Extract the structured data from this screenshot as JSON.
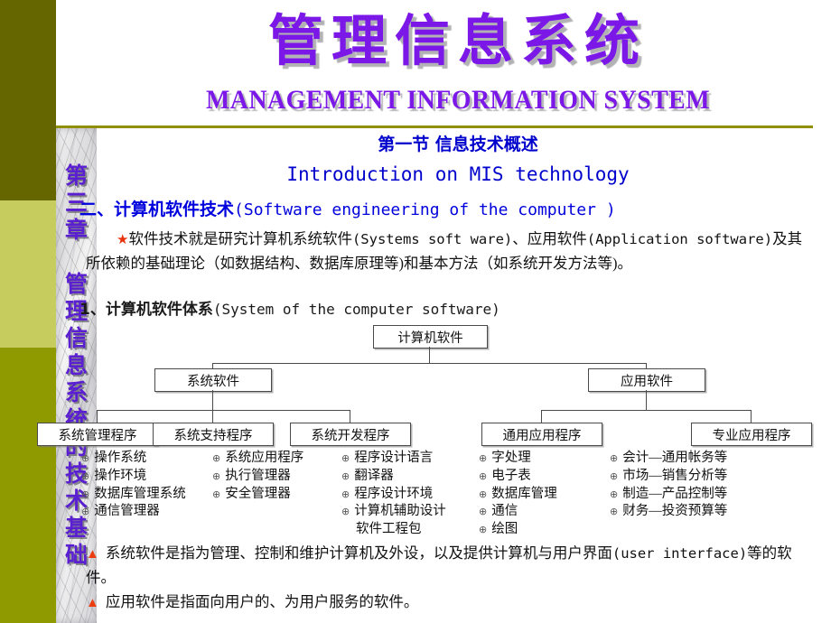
{
  "theme": {
    "band_dark": "#666600",
    "band_light": "#c6cc5e",
    "band_mid": "#8f9900",
    "title_purple": "#7b18e8",
    "heading_blue": "#0000cc",
    "accent_red": "#e8300a",
    "rule_olive": "#8f8f00"
  },
  "sidebar": {
    "vertical_title": "第三章 管理信息系统的技术基础"
  },
  "header": {
    "title_cn": "管理信息系统",
    "title_en": "MANAGEMENT INFORMATION SYSTEM"
  },
  "section": {
    "heading_cn": "第一节 信息技术概述",
    "heading_en": "Introduction on MIS technology",
    "h2_cn": "二、计算机软件技术",
    "h2_en": "(Software engineering of the computer )",
    "h3_cn": "1、计算机软件体系",
    "h3_en": "(System of the computer software)"
  },
  "paragraph": {
    "bullet": "★",
    "text": "软件技术就是研究计算机系统软件(Systems soft ware)、应用软件(Application software)及其所依赖的基础理论（如数据结构、数据库原理等)和基本方法（如系统开发方法等)。",
    "line1_pre": "软件技术就是研究计算机系统软件",
    "line1_mono": "(Systems soft ware)",
    "line1_post": "、应用软件",
    "line2_mono": "(Application software)",
    "line2_post": "及其所依赖的基础理论（如数据结构、数据库原理等)和基本方法（如系统开发方法等)。"
  },
  "tree": {
    "root": "计算机软件",
    "branches": [
      {
        "label": "系统软件",
        "children": [
          "系统管理程序",
          "系统支持程序",
          "系统开发程序"
        ]
      },
      {
        "label": "应用软件",
        "children": [
          "通用应用程序",
          "专业应用程序"
        ]
      }
    ]
  },
  "lists": [
    {
      "parent": "系统管理程序",
      "items": [
        "操作系统",
        "操作环境",
        "数据库管理系统",
        "通信管理器"
      ]
    },
    {
      "parent": "系统支持程序",
      "items": [
        "系统应用程序",
        "执行管理器",
        "安全管理器"
      ]
    },
    {
      "parent": "系统开发程序",
      "items": [
        "程序设计语言",
        "翻译器",
        "程序设计环境",
        "计算机辅助设计"
      ],
      "continuation": "软件工程包"
    },
    {
      "parent": "通用应用程序",
      "items": [
        "字处理",
        "电子表",
        "数据库管理",
        "通信",
        "绘图"
      ]
    },
    {
      "parent": "专业应用程序",
      "items": [
        "会计—通用帐务等",
        "市场—销售分析等",
        "制造—产品控制等",
        "财务—投资预算等"
      ]
    }
  ],
  "notes": {
    "marker": "▲",
    "items": [
      {
        "pre": "系统软件是指为管理、控制和维护计算机及外设，以及提供计算机与用户界面",
        "mono": "(user interface)",
        "post": "等的软件。"
      },
      {
        "pre": "应用软件是指面向用户的、为用户服务的软件。",
        "mono": "",
        "post": ""
      }
    ]
  },
  "bullet_glyph": "⊕"
}
